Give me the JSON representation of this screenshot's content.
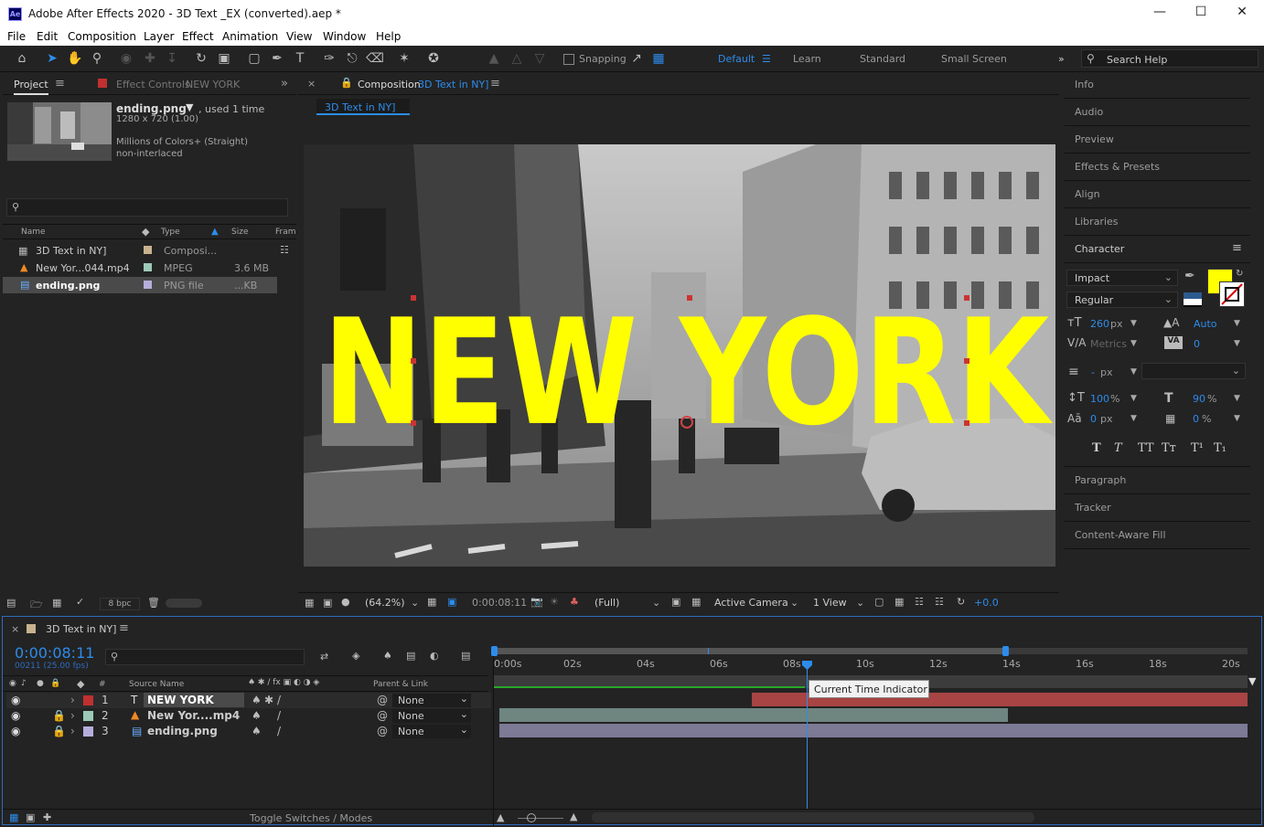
{
  "window": {
    "title": "Adobe After Effects 2020 - 3D Text _EX (converted).aep *",
    "app_badge": "Ae"
  },
  "menu": [
    "File",
    "Edit",
    "Composition",
    "Layer",
    "Effect",
    "Animation",
    "View",
    "Window",
    "Help"
  ],
  "toolbar": {
    "snapping": "Snapping",
    "workspaces": [
      "Default",
      "Learn",
      "Standard",
      "Small Screen"
    ],
    "search_placeholder": "Search Help"
  },
  "project": {
    "tab": "Project",
    "effect_tab_prefix": "Effect Controls",
    "effect_tab_target": "NEW YORK",
    "preview": {
      "name": "ending.png",
      "used": ", used 1 time",
      "dims": "1280 x 720 (1.00)",
      "colors": "Millions of Colors+ (Straight)",
      "interlace": "non-interlaced"
    },
    "columns": [
      "Name",
      "Type",
      "Size",
      "Fram"
    ],
    "items": [
      {
        "name": "3D Text in NY]",
        "type": "Composi...",
        "size": "",
        "swatch": "#c9b28f"
      },
      {
        "name": "New Yor...044.mp4",
        "type": "MPEG",
        "size": "3.6 MB",
        "swatch": "#9cc9b8"
      },
      {
        "name": "ending.png",
        "type": "PNG file",
        "size": "...KB",
        "swatch": "#b5aedb"
      }
    ],
    "bpc": "8 bpc"
  },
  "composition": {
    "tab_prefix": "Composition",
    "tab_name": "3D Text in NY]",
    "sub_tab": "3D Text in NY]",
    "viewer_text": "NEW YORK",
    "zoom": "(64.2%)",
    "timecode": "0:00:08:11",
    "resolution": "(Full)",
    "camera": "Active Camera",
    "views": "1 View",
    "exposure": "+0.0"
  },
  "right_panels": {
    "items_top": [
      "Info",
      "Audio",
      "Preview",
      "Effects & Presets",
      "Align",
      "Libraries"
    ],
    "character": {
      "title": "Character",
      "font": "Impact",
      "style": "Regular",
      "size": "260",
      "size_unit": "px",
      "leading": "Auto",
      "kerning": "Metrics",
      "tracking": "0",
      "stroke": "-",
      "stroke_unit": "px",
      "vscale": "100",
      "hscale": "90",
      "baseline": "0",
      "baseline_unit": "px",
      "tsume": "0",
      "pct": "%",
      "fill_color": "#ffff00",
      "format_buttons": [
        "T",
        "T",
        "TT",
        "Tт",
        "T¹",
        "T₁"
      ]
    },
    "items_bottom": [
      "Paragraph",
      "Tracker",
      "Content-Aware Fill"
    ]
  },
  "timeline": {
    "tab": "3D Text in NY]",
    "timecode": "0:00:08:11",
    "frames": "00211 (25.00 fps)",
    "ruler": [
      "0:00s",
      "02s",
      "04s",
      "06s",
      "08s",
      "10s",
      "12s",
      "14s",
      "16s",
      "18s",
      "20s"
    ],
    "col_hash": "#",
    "col_source": "Source Name",
    "col_parent": "Parent & Link",
    "tooltip": "Current Time Indicator",
    "layers": [
      {
        "num": "1",
        "name": "NEW YORK",
        "label_color": "#c03030",
        "parent": "None",
        "bar_color": "#a84444"
      },
      {
        "num": "2",
        "name": "New Yor....mp4",
        "label_color": "#9cc9b8",
        "parent": "None",
        "bar_color": "#6e8580"
      },
      {
        "num": "3",
        "name": "ending.png",
        "label_color": "#b5aedb",
        "parent": "None",
        "bar_color": "#7c7a95"
      }
    ],
    "toggle": "Toggle Switches / Modes"
  }
}
